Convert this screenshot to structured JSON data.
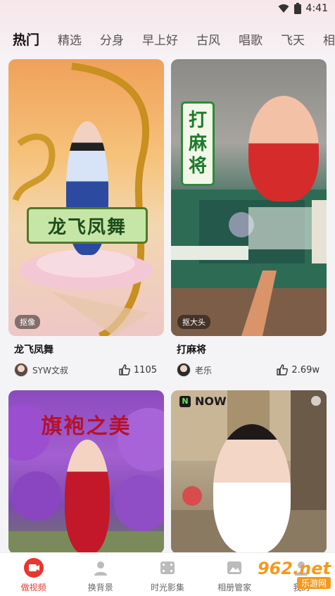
{
  "status_bar": {
    "time": "4:41"
  },
  "tabs": [
    {
      "label": "热门",
      "active": true
    },
    {
      "label": "精选"
    },
    {
      "label": "分身"
    },
    {
      "label": "早上好"
    },
    {
      "label": "古风"
    },
    {
      "label": "唱歌"
    },
    {
      "label": "飞天"
    },
    {
      "label": "相"
    }
  ],
  "cards": [
    {
      "title": "龙飞凤舞",
      "badge": "抠像",
      "poster_text": "龙飞凤舞",
      "author": "SYW文叔",
      "likes": "1105"
    },
    {
      "title": "打麻将",
      "badge": "抠大头",
      "poster_text": [
        "打",
        "麻",
        "将"
      ],
      "author": "老乐",
      "likes": "2.69w"
    },
    {
      "title": "",
      "poster_text": "旗袍之美"
    },
    {
      "title": "",
      "brand": "NOW"
    }
  ],
  "bottom_nav": [
    {
      "label": "做视频",
      "icon": "video-camera-icon",
      "active": true
    },
    {
      "label": "换背景",
      "icon": "person-swap-icon"
    },
    {
      "label": "时光影集",
      "icon": "film-icon"
    },
    {
      "label": "相册管家",
      "icon": "album-icon"
    },
    {
      "label": "我的",
      "icon": "user-icon"
    }
  ],
  "watermark": {
    "top": "962.net",
    "bottom": "乐游网"
  },
  "colors": {
    "accent": "#e8362f",
    "badge_bg": "rgba(0,0,0,0.45)"
  }
}
